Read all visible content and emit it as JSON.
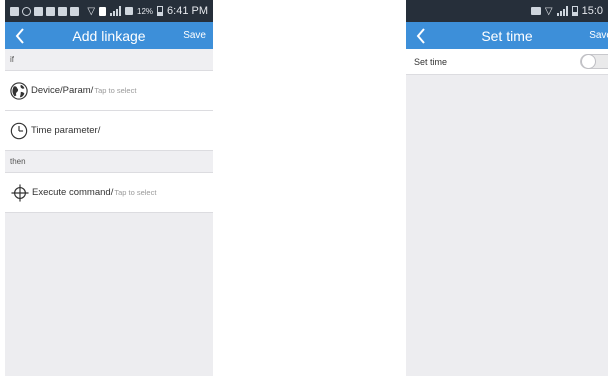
{
  "left": {
    "status": {
      "battery": "12%",
      "time": "6:41 PM"
    },
    "toolbar": {
      "title": "Add linkage",
      "save": "Save"
    },
    "sections": {
      "if": "if",
      "then": "then"
    },
    "rows": {
      "device": {
        "label": "Device/Param",
        "hint": "Tap to select",
        "icon": "globe-icon"
      },
      "time": {
        "label": "Time parameter/",
        "hint": "",
        "icon": "clock-icon"
      },
      "execute": {
        "label": "Execute command",
        "hint": "Tap to select",
        "icon": "crosshair-icon"
      }
    }
  },
  "right": {
    "status": {
      "time": "15:0"
    },
    "toolbar": {
      "title": "Set time",
      "save": "Save"
    },
    "set_time": {
      "label": "Set time",
      "toggle_on": false
    }
  },
  "colors": {
    "statusbar": "#262f3a",
    "toolbar": "#3d8fd9",
    "background": "#ededf0"
  }
}
